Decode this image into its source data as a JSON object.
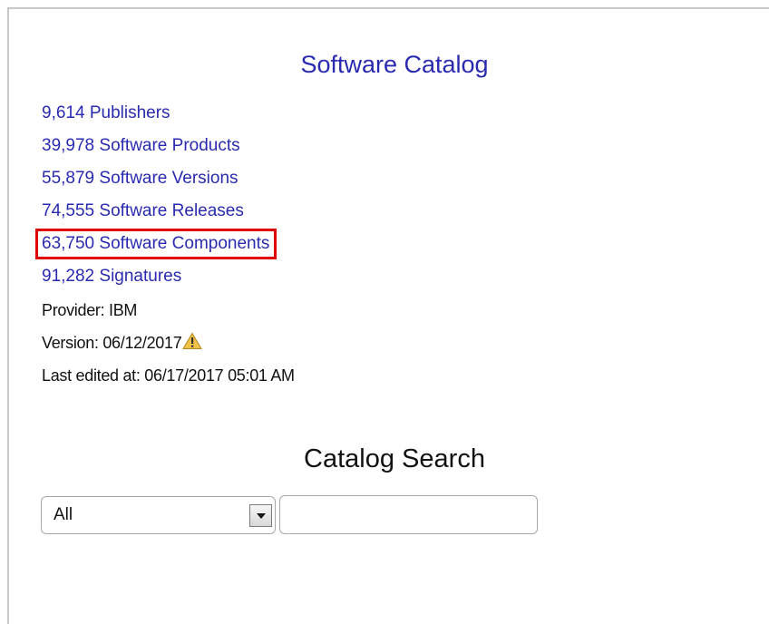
{
  "catalog": {
    "title": "Software Catalog",
    "links": [
      {
        "label": "9,614 Publishers"
      },
      {
        "label": "39,978 Software Products"
      },
      {
        "label": "55,879 Software Versions"
      },
      {
        "label": "74,555 Software Releases"
      },
      {
        "label": "63,750 Software Components",
        "highlighted": true
      },
      {
        "label": "91,282 Signatures"
      }
    ],
    "provider": "Provider: IBM",
    "version": "Version: 06/12/2017",
    "version_icon": "warning-icon",
    "last_edited": "Last edited at: 06/17/2017 05:01 AM"
  },
  "search": {
    "title": "Catalog Search",
    "scope_value": "All",
    "query_value": "",
    "query_placeholder": ""
  },
  "colors": {
    "link": "#2a2ab0",
    "highlight": "#e00000",
    "warning": "#f0c020"
  }
}
